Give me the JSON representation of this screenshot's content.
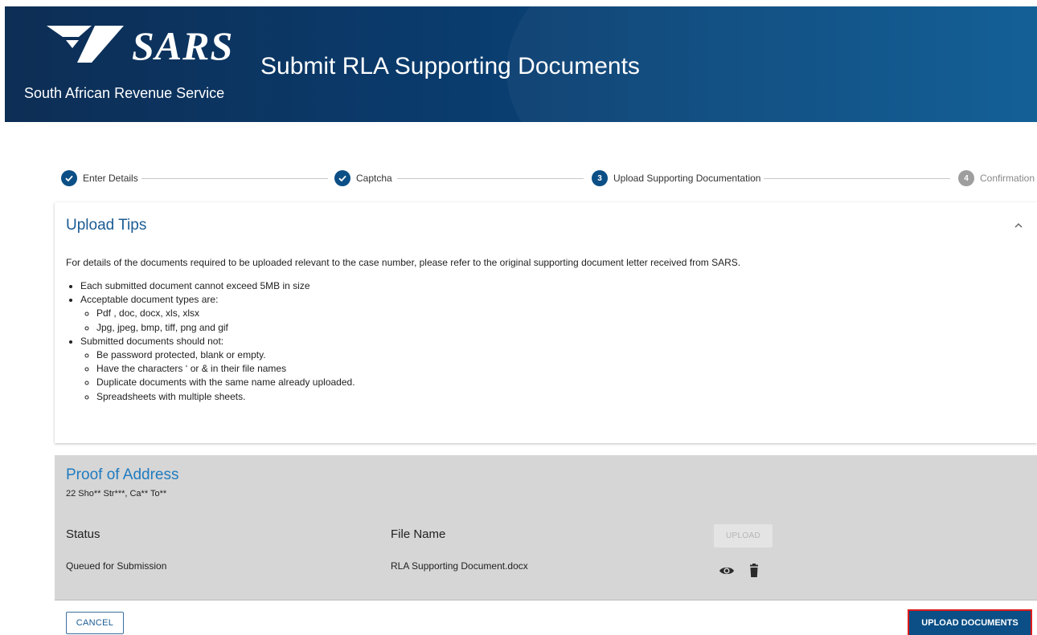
{
  "header": {
    "logo_text": "SARS",
    "subtitle": "South African Revenue Service",
    "page_title": "Submit RLA Supporting Documents"
  },
  "stepper": {
    "steps": [
      {
        "label": "Enter Details",
        "state": "complete",
        "number": "1"
      },
      {
        "label": "Captcha",
        "state": "complete",
        "number": "2"
      },
      {
        "label": "Upload Supporting Documentation",
        "state": "active",
        "number": "3"
      },
      {
        "label": "Confirmation",
        "state": "inactive",
        "number": "4"
      }
    ]
  },
  "tips": {
    "title": "Upload Tips",
    "intro": "For details of the documents required to be uploaded relevant to the case number, please refer to the original supporting document letter received from SARS.",
    "items": [
      {
        "text": "Each submitted document cannot exceed 5MB in size",
        "sub": []
      },
      {
        "text": "Acceptable document types are:",
        "sub": [
          "Pdf , doc, docx, xls, xlsx",
          "Jpg, jpeg, bmp, tiff, png and gif"
        ]
      },
      {
        "text": "Submitted documents should not:",
        "sub": [
          "Be password protected, blank or empty.",
          "Have the characters ‘ or & in their file names",
          "Duplicate documents with the same name already uploaded.",
          "Spreadsheets with multiple sheets."
        ]
      }
    ]
  },
  "document": {
    "title": "Proof of Address",
    "address": "22 Sho** Str***, Ca** To**",
    "status_header": "Status",
    "file_name_header": "File Name",
    "upload_label": "UPLOAD",
    "status_value": "Queued for Submission",
    "file_name_value": "RLA Supporting Document.docx"
  },
  "footer": {
    "cancel_label": "CANCEL",
    "upload_documents_label": "UPLOAD DOCUMENTS"
  },
  "colors": {
    "brand_blue": "#0b4f86",
    "title_blue": "#1b5c93",
    "highlight_red": "#e01b1b"
  },
  "icons": [
    "sars-logo-icon",
    "check-icon",
    "chevron-up-icon",
    "eye-icon",
    "trash-icon"
  ]
}
